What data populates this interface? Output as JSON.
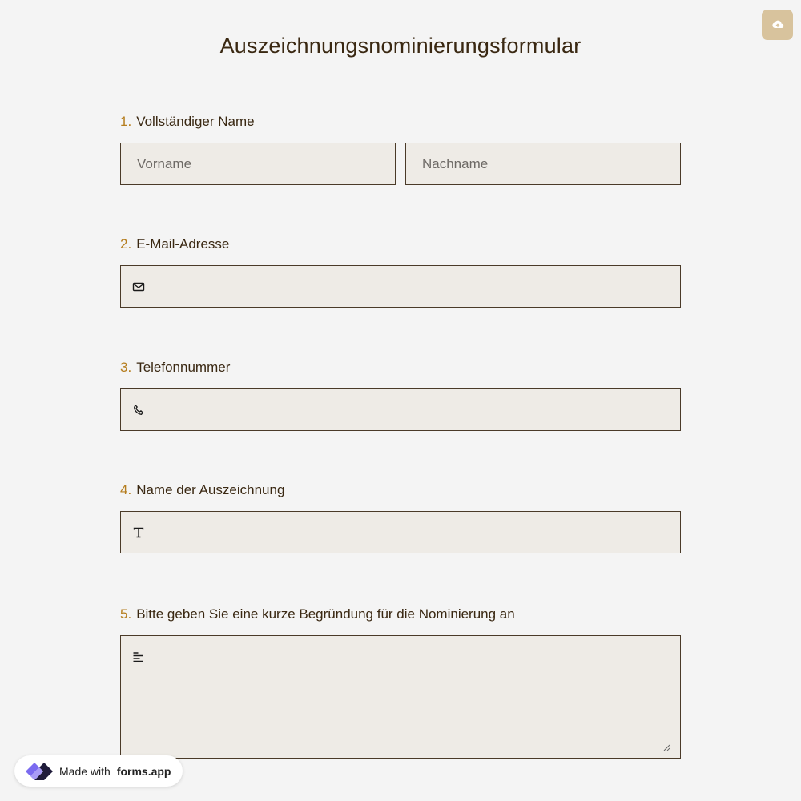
{
  "header": {
    "title": "Auszeichnungsnominierungsformular",
    "save_icon": "cloud-upload-icon"
  },
  "questions": [
    {
      "number": "1.",
      "label": "Vollständiger Name",
      "first_placeholder": "Vorname",
      "last_placeholder": "Nachname"
    },
    {
      "number": "2.",
      "label": "E-Mail-Adresse",
      "icon": "mail-icon"
    },
    {
      "number": "3.",
      "label": "Telefonnummer",
      "icon": "phone-icon"
    },
    {
      "number": "4.",
      "label": "Name der Auszeichnung",
      "icon": "text-type-icon"
    },
    {
      "number": "5.",
      "label": "Bitte geben Sie eine kurze Begründung für die Nominierung an",
      "icon": "align-left-icon"
    }
  ],
  "badge": {
    "prefix": "Made with",
    "brand": "forms.app"
  },
  "colors": {
    "background": "#f4f4f4",
    "field_background": "#eeebe6",
    "field_border": "#4a3a28",
    "title_text": "#3a2812",
    "number_accent": "#b57d1e",
    "save_button": "#d8c39d"
  }
}
